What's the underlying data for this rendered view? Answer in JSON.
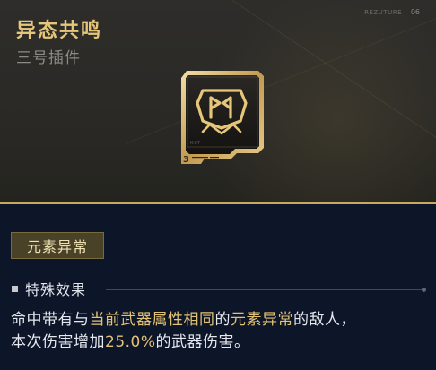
{
  "header": {
    "title": "异态共鸣",
    "subtitle": "三号插件",
    "tag": "REZUTURE",
    "tag_number": "06"
  },
  "chip": {
    "icon": "resonance-emblem-icon",
    "slot_number": "3",
    "corner_mark": "K-07"
  },
  "element_badge": {
    "label": "元素异常"
  },
  "section": {
    "label": "特殊效果"
  },
  "description": {
    "s1": "命中带有与",
    "h1": "当前武器属性相同",
    "s2": "的",
    "h2": "元素异常",
    "s3": "的敌人，",
    "s4": "本次伤害增加",
    "h3": "25.0%",
    "s5": "的武器伤害。"
  },
  "colors": {
    "accent_gold": "#e2c274",
    "panel_dark": "#0d1528",
    "top_bg": "#2e2d2a"
  }
}
